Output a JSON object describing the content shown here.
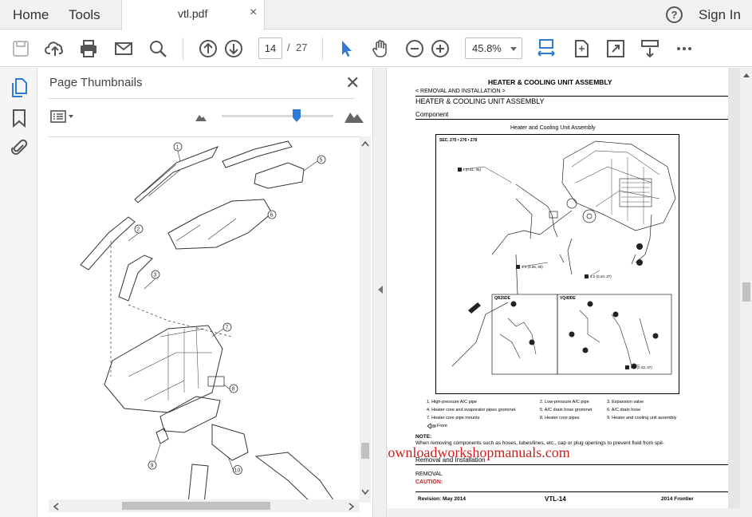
{
  "tabs": {
    "home": "Home",
    "tools": "Tools",
    "document": "vtl.pdf",
    "close_glyph": "×"
  },
  "header": {
    "help_glyph": "?",
    "sign_in": "Sign In"
  },
  "toolbar": {
    "current_page": "14",
    "page_separator": "/",
    "total_pages": "27",
    "zoom": "45.8%",
    "accent_color": "#2d7bd6"
  },
  "thumbnails_panel": {
    "title": "Page Thumbnails",
    "close_glyph": "✕",
    "callouts": [
      "1",
      "2",
      "3",
      "5",
      "6",
      "7",
      "8",
      "9",
      "10"
    ]
  },
  "document": {
    "title": "HEATER & COOLING UNIT ASSEMBLY",
    "breadcrumb": "< REMOVAL AND INSTALLATION >",
    "section_heading": "HEATER & COOLING UNIT ASSEMBLY",
    "subsection": "Component",
    "figure_title": "Heater and Cooling Unit Assembly",
    "figure_sec": "SEC. 270 • 276 • 278",
    "inset_left_label": "QR25DE",
    "inset_right_label": "VQ40DE",
    "torque_labels": [
      "4 (0.41, 35)",
      "3.4 (0.35, 30)",
      "4.2 (0.43, 37)",
      "4.2 (0.43, 37)"
    ],
    "legend": [
      "1.    High-pressure A/C pipe",
      "4.    Heater core and evaporator pipes grommet",
      "7.    Heater core pipe mounts",
      "2.    Low-pressure A/C pipe",
      "5.    A/C drain hose grommet",
      "8.    Heater core pipes",
      "3.    Expansion valve",
      "6.    A/C drain hose",
      "9.    Heater and cooling unit assembly"
    ],
    "front_label": "Front",
    "note_label": "NOTE:",
    "note_text": "When removing components such as hoses, tubes/lines, etc., cap or plug openings to prevent fluid from spil-",
    "watermark": "www.downloadworkshopmanuals.com",
    "watermark_color": "#d01e1e",
    "removal_heading": "Removal and Installation",
    "removal_label": "REMOVAL",
    "caution_label": "CAUTION:",
    "footer_revision": "Revision: May 2014",
    "footer_page": "VTL-14",
    "footer_model": "2014 Frontier"
  }
}
